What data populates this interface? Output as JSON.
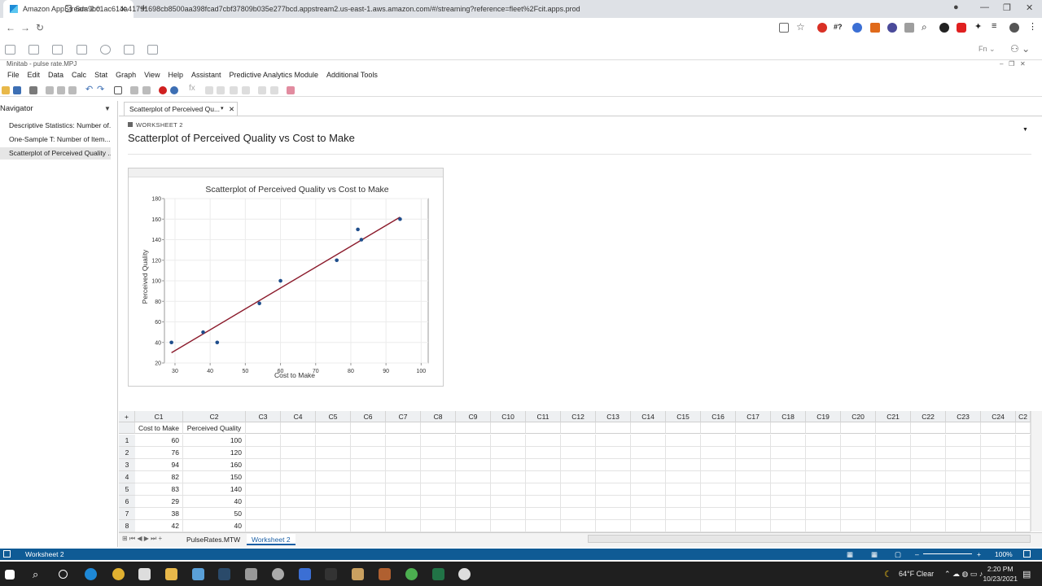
{
  "browser": {
    "tab_title": "Amazon AppStream 2.0",
    "url": "5da9bc1ac614a41791698cb8500aa398fcad7cbf37809b035e277bcd.appstream2.us-east-1.aws.amazon.com/#/streaming?reference=fleet%2Fcit.apps.prod",
    "ext_hash": "#?"
  },
  "app": {
    "window_title": "Minitab - pulse rate.MPJ",
    "menu": [
      "File",
      "Edit",
      "Data",
      "Calc",
      "Stat",
      "Graph",
      "View",
      "Help",
      "Assistant",
      "Predictive Analytics Module",
      "Additional Tools"
    ]
  },
  "navigator": {
    "title": "Navigator",
    "items": [
      "Descriptive Statistics: Number of...",
      "One-Sample T: Number of Item...",
      "Scatterplot of Perceived Quality ..."
    ]
  },
  "document": {
    "tab_label": "Scatterplot of Perceived Qu...",
    "worksheet_label": "WORKSHEET 2",
    "title": "Scatterplot of Perceived Quality vs Cost to Make"
  },
  "chart_data": {
    "type": "scatter",
    "title": "Scatterplot of Perceived Quality vs Cost to Make",
    "xlabel": "Cost to Make",
    "ylabel": "Perceived Quality",
    "xlim": [
      27,
      102
    ],
    "ylim": [
      20,
      180
    ],
    "xticks": [
      30,
      40,
      50,
      60,
      70,
      80,
      90,
      100
    ],
    "yticks": [
      20,
      40,
      60,
      80,
      100,
      120,
      140,
      160,
      180
    ],
    "grid": true,
    "points": [
      {
        "x": 60,
        "y": 100
      },
      {
        "x": 76,
        "y": 120
      },
      {
        "x": 94,
        "y": 160
      },
      {
        "x": 82,
        "y": 150
      },
      {
        "x": 83,
        "y": 140
      },
      {
        "x": 29,
        "y": 40
      },
      {
        "x": 38,
        "y": 50
      },
      {
        "x": 42,
        "y": 40
      },
      {
        "x": 54,
        "y": 78
      }
    ],
    "fit_line": {
      "x": [
        29,
        94
      ],
      "y": [
        30,
        162
      ]
    },
    "point_color": "#1f4e8c",
    "line_color": "#8b1a2b"
  },
  "grid": {
    "columns": [
      "C1",
      "C2",
      "C3",
      "C4",
      "C5",
      "C6",
      "C7",
      "C8",
      "C9",
      "C10",
      "C11",
      "C12",
      "C13",
      "C14",
      "C15",
      "C16",
      "C17",
      "C18",
      "C19",
      "C20",
      "C21",
      "C22",
      "C23",
      "C24",
      "C2"
    ],
    "names": [
      "Cost to Make",
      "Perceived Quality"
    ],
    "rows": [
      [
        60,
        100
      ],
      [
        76,
        120
      ],
      [
        94,
        160
      ],
      [
        82,
        150
      ],
      [
        83,
        140
      ],
      [
        29,
        40
      ],
      [
        38,
        50
      ],
      [
        42,
        40
      ]
    ]
  },
  "sheet_tabs": [
    "PulseRates.MTW",
    "Worksheet 2"
  ],
  "status": {
    "left": "Worksheet 2",
    "zoom": "100%"
  },
  "taskbar": {
    "weather": "64°F  Clear",
    "time": "2:20 PM",
    "date": "10/23/2021"
  }
}
